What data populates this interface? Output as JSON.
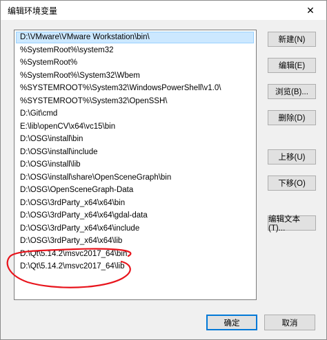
{
  "window": {
    "title": "编辑环境变量",
    "close_glyph": "✕"
  },
  "path_list": {
    "items": [
      "D:\\VMware\\VMware Workstation\\bin\\",
      "%SystemRoot%\\system32",
      "%SystemRoot%",
      "%SystemRoot%\\System32\\Wbem",
      "%SYSTEMROOT%\\System32\\WindowsPowerShell\\v1.0\\",
      "%SYSTEMROOT%\\System32\\OpenSSH\\",
      "D:\\Git\\cmd",
      "E:\\lib\\openCV\\x64\\vc15\\bin",
      "D:\\OSG\\install\\bin",
      "D:\\OSG\\install\\include",
      "D:\\OSG\\install\\lib",
      "D:\\OSG\\install\\share\\OpenSceneGraph\\bin",
      "D:\\OSG\\OpenSceneGraph-Data",
      "D:\\OSG\\3rdParty_x64\\x64\\bin",
      "D:\\OSG\\3rdParty_x64\\x64\\gdal-data",
      "D:\\OSG\\3rdParty_x64\\x64\\include",
      "D:\\OSG\\3rdParty_x64\\x64\\lib",
      "D:\\Qt\\5.14.2\\msvc2017_64\\bin",
      "D:\\Qt\\5.14.2\\msvc2017_64\\lib"
    ]
  },
  "buttons": {
    "new": "新建(N)",
    "edit": "编辑(E)",
    "browse": "浏览(B)...",
    "delete": "删除(D)",
    "move_up": "上移(U)",
    "move_down": "下移(O)",
    "edit_text": "编辑文本(T)...",
    "ok": "确定",
    "cancel": "取消"
  },
  "colors": {
    "selection": "#cce8ff",
    "annotation": "#e8141c"
  }
}
